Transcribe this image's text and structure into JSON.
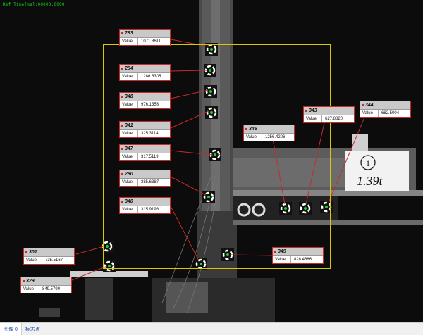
{
  "overlay": {
    "ref_time": "Ref Time[ms]:00000.0000"
  },
  "tags": [
    {
      "id": "293",
      "key": "Value",
      "value": "1071.8611"
    },
    {
      "id": "294",
      "key": "Value",
      "value": "1286.6305"
    },
    {
      "id": "348",
      "key": "Value",
      "value": "976.1353"
    },
    {
      "id": "341",
      "key": "Value",
      "value": "325.3114"
    },
    {
      "id": "347",
      "key": "Value",
      "value": "317.5119"
    },
    {
      "id": "280",
      "key": "Value",
      "value": "385.6387"
    },
    {
      "id": "340",
      "key": "Value",
      "value": "315.9196"
    },
    {
      "id": "301",
      "key": "Value",
      "value": "735.5167"
    },
    {
      "id": "329",
      "key": "Value",
      "value": "849.5790"
    },
    {
      "id": "346",
      "key": "Value",
      "value": "1256.4206"
    },
    {
      "id": "343",
      "key": "Value",
      "value": "627.8820"
    },
    {
      "id": "344",
      "key": "Value",
      "value": "682.5004"
    },
    {
      "id": "349",
      "key": "Value",
      "value": "828.4686"
    }
  ],
  "scene": {
    "placard_number": "1",
    "placard_text": "1.39t"
  },
  "colors": {
    "tag_border": "#c62b2b",
    "roi": "#d8c800",
    "target_label": "#19d419"
  },
  "statusbar": {
    "tab_image": "图像 0",
    "tab_markers": "标志点"
  }
}
